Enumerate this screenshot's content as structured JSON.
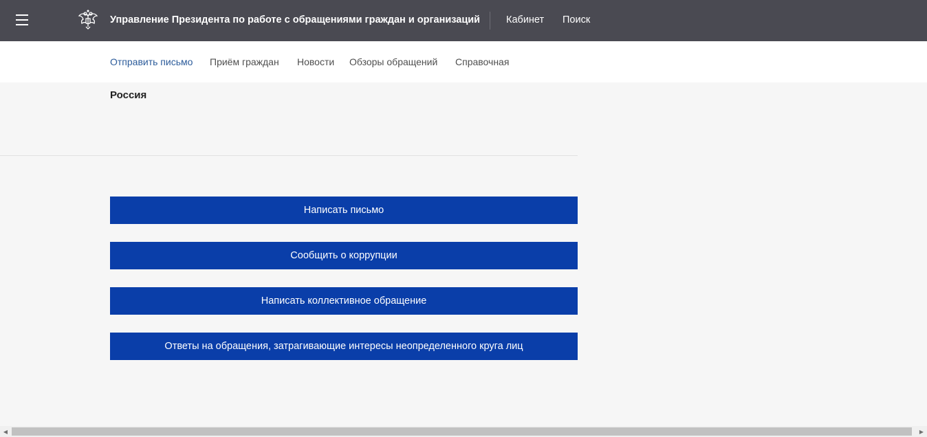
{
  "header": {
    "menu_icon": "hamburger-icon",
    "emblem_icon": "double-headed-eagle-icon",
    "title": "Управление Президента по работе с обращениями граждан и организаций",
    "links": [
      "Кабинет",
      "Поиск"
    ],
    "colors": {
      "background": "#4a4a52",
      "text": "#ffffff"
    }
  },
  "nav": {
    "items": [
      {
        "label": "Отправить письмо",
        "active": true
      },
      {
        "label": "Приём граждан",
        "active": false
      },
      {
        "label": "Новости",
        "active": false
      },
      {
        "label": "Обзоры обращений",
        "active": false
      },
      {
        "label": "Справочная",
        "active": false
      }
    ],
    "active_color": "#2b5b9a"
  },
  "content": {
    "country": "Россия"
  },
  "actions": {
    "buttons": [
      "Написать письмо",
      "Сообщить о коррупции",
      "Написать коллективное обращение",
      "Ответы на обращения, затрагивающие интересы неопределенного круга лиц"
    ],
    "button_color": "#0a3ea9"
  },
  "scrollbar": {
    "left_icon": "arrow-left-icon",
    "right_icon": "arrow-right-icon"
  }
}
